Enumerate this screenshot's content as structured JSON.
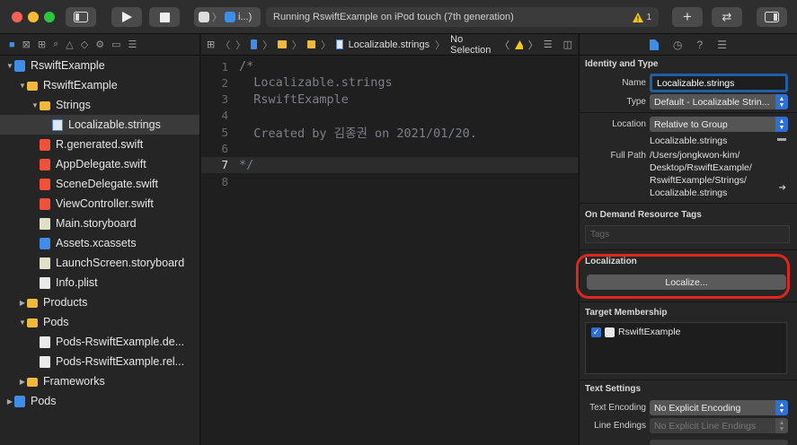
{
  "toolbar": {
    "scheme_label": "i...)",
    "status_text": "Running RswiftExample on iPod touch (7th generation)",
    "warning_count": "1"
  },
  "navigator": {
    "items": [
      {
        "label": "RswiftExample",
        "icon": "project-icon",
        "type": "proj",
        "level": 0,
        "disclosure": "▼"
      },
      {
        "label": "RswiftExample",
        "icon": "folder-icon",
        "type": "folder",
        "level": 1,
        "disclosure": "▼"
      },
      {
        "label": "Strings",
        "icon": "folder-icon",
        "type": "folder",
        "level": 2,
        "disclosure": "▼"
      },
      {
        "label": "Localizable.strings",
        "icon": "strings-file-icon",
        "type": "doc-strings",
        "level": 3,
        "disclosure": "",
        "selected": true
      },
      {
        "label": "R.generated.swift",
        "icon": "swift-file-icon",
        "type": "swift",
        "level": 2,
        "disclosure": ""
      },
      {
        "label": "AppDelegate.swift",
        "icon": "swift-file-icon",
        "type": "swift",
        "level": 2,
        "disclosure": ""
      },
      {
        "label": "SceneDelegate.swift",
        "icon": "swift-file-icon",
        "type": "swift",
        "level": 2,
        "disclosure": ""
      },
      {
        "label": "ViewController.swift",
        "icon": "swift-file-icon",
        "type": "swift",
        "level": 2,
        "disclosure": ""
      },
      {
        "label": "Main.storyboard",
        "icon": "storyboard-icon",
        "type": "storyboard",
        "level": 2,
        "disclosure": ""
      },
      {
        "label": "Assets.xcassets",
        "icon": "assets-icon",
        "type": "assets",
        "level": 2,
        "disclosure": ""
      },
      {
        "label": "LaunchScreen.storyboard",
        "icon": "storyboard-icon",
        "type": "storyboard",
        "level": 2,
        "disclosure": ""
      },
      {
        "label": "Info.plist",
        "icon": "plist-icon",
        "type": "plist",
        "level": 2,
        "disclosure": ""
      },
      {
        "label": "Products",
        "icon": "folder-icon",
        "type": "folder",
        "level": 1,
        "disclosure": "▶"
      },
      {
        "label": "Pods",
        "icon": "folder-icon",
        "type": "folder",
        "level": 1,
        "disclosure": "▼"
      },
      {
        "label": "Pods-RswiftExample.de...",
        "icon": "config-file-icon",
        "type": "plist",
        "level": 2,
        "disclosure": ""
      },
      {
        "label": "Pods-RswiftExample.rel...",
        "icon": "config-file-icon",
        "type": "plist",
        "level": 2,
        "disclosure": ""
      },
      {
        "label": "Frameworks",
        "icon": "folder-icon",
        "type": "folder",
        "level": 1,
        "disclosure": "▶"
      },
      {
        "label": "Pods",
        "icon": "project-icon",
        "type": "proj",
        "level": 0,
        "disclosure": "▶"
      }
    ]
  },
  "editor": {
    "jump_file": "Localizable.strings",
    "jump_selection": "No Selection",
    "lines": [
      {
        "n": "1",
        "text": "/*"
      },
      {
        "n": "2",
        "text": "  Localizable.strings"
      },
      {
        "n": "3",
        "text": "  RswiftExample"
      },
      {
        "n": "4",
        "text": ""
      },
      {
        "n": "5",
        "text": "  Created by 김종권 on 2021/01/20."
      },
      {
        "n": "6",
        "text": ""
      },
      {
        "n": "7",
        "text": "*/",
        "current": true
      },
      {
        "n": "8",
        "text": ""
      }
    ]
  },
  "inspector": {
    "identity_title": "Identity and Type",
    "name_label": "Name",
    "name_value": "Localizable.strings",
    "type_label": "Type",
    "type_value": "Default - Localizable Strin...",
    "location_label": "Location",
    "location_value": "Relative to Group",
    "location_file": "Localizable.strings",
    "full_path_label": "Full Path",
    "full_path_lines": [
      "/Users/jongkwon-kim/",
      "Desktop/RswiftExample/",
      "RswiftExample/Strings/",
      "Localizable.strings"
    ],
    "odr_title": "On Demand Resource Tags",
    "tags_placeholder": "Tags",
    "localization_title": "Localization",
    "localize_button": "Localize...",
    "target_membership_title": "Target Membership",
    "target_name": "RswiftExample",
    "text_settings_title": "Text Settings",
    "text_encoding_label": "Text Encoding",
    "text_encoding_value": "No Explicit Encoding",
    "line_endings_label": "Line Endings",
    "line_endings_value": "No Explicit Line Endings"
  }
}
